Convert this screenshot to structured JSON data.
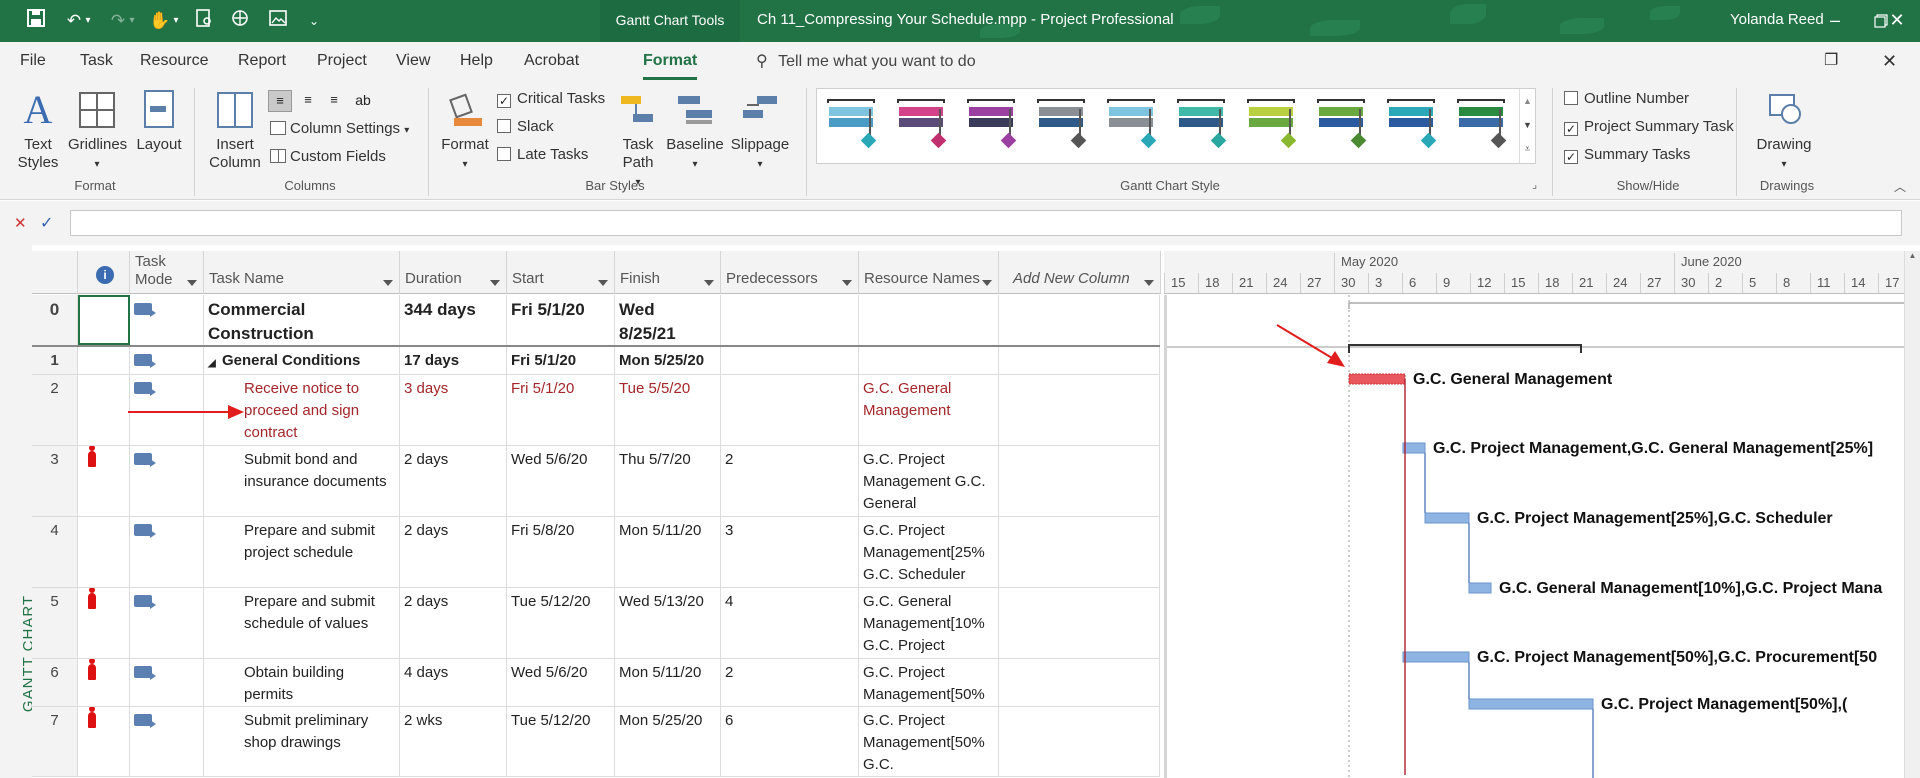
{
  "titlebar": {
    "context_tab": "Gantt Chart Tools",
    "doc_title": "Ch 11_Compressing Your Schedule.mpp  -  Project Professional",
    "user": "Yolanda Reed",
    "qat_more": "⌄"
  },
  "menu": {
    "items": [
      "File",
      "Task",
      "Resource",
      "Report",
      "Project",
      "View",
      "Help",
      "Acrobat",
      "Format"
    ],
    "active": "Format",
    "tell_me": "Tell me what you want to do"
  },
  "ribbon": {
    "format_group": {
      "text_styles": "Text Styles",
      "gridlines": "Gridlines",
      "layout": "Layout",
      "label": "Format"
    },
    "columns_group": {
      "insert_column": "Insert Column",
      "column_settings": "Column Settings",
      "custom_fields": "Custom Fields",
      "label": "Columns"
    },
    "bar_styles_group": {
      "format": "Format",
      "critical_tasks": "Critical Tasks",
      "slack": "Slack",
      "late_tasks": "Late Tasks",
      "task_path": "Task Path",
      "baseline": "Baseline",
      "slippage": "Slippage",
      "label": "Bar Styles",
      "critical_checked": true,
      "slack_checked": false,
      "late_checked": false
    },
    "gantt_style_label": "Gantt Chart Style",
    "gantt_styles": [
      {
        "top": "#7fc4de",
        "bottom": "#4a9cc4",
        "diamond": "#2aa8b8"
      },
      {
        "top": "#d4438a",
        "bottom": "#5a4b7a",
        "diamond": "#c0306e"
      },
      {
        "top": "#9b3fa0",
        "bottom": "#3a3a5a",
        "diamond": "#9b3fa0"
      },
      {
        "top": "#8a8f96",
        "bottom": "#2e5a8a",
        "diamond": "#555555"
      },
      {
        "top": "#7fc4de",
        "bottom": "#8a8f96",
        "diamond": "#2aa8b8"
      },
      {
        "top": "#3fb8a8",
        "bottom": "#2e5a8a",
        "diamond": "#2aa8a0"
      },
      {
        "top": "#b8d040",
        "bottom": "#6aa840",
        "diamond": "#8ab830"
      },
      {
        "top": "#6aa840",
        "bottom": "#2a5aa0",
        "diamond": "#4a8a30"
      },
      {
        "top": "#2aa8b8",
        "bottom": "#2a5aa0",
        "diamond": "#2aa8b8"
      },
      {
        "top": "#2a8a40",
        "bottom": "#3a6aa8",
        "diamond": "#555555"
      }
    ],
    "show_hide": {
      "outline_number": "Outline Number",
      "project_summary_task": "Project Summary Task",
      "summary_tasks": "Summary Tasks",
      "label": "Show/Hide",
      "outline_checked": false,
      "project_summary_checked": true,
      "summary_checked": true
    },
    "drawings": {
      "drawing": "Drawing",
      "label": "Drawings"
    }
  },
  "formula": {
    "cancel": "✕",
    "enter": "✓",
    "value": ""
  },
  "side_label": "GANTT CHART",
  "columns": [
    "",
    "Task Mode",
    "Task Name",
    "Duration",
    "Start",
    "Finish",
    "Predecessors",
    "Resource Names",
    "Add New Column"
  ],
  "rows": [
    {
      "id": "0",
      "mode": "auto",
      "name": "Commercial Construction",
      "indent": 0,
      "summary": true,
      "big": true,
      "duration": "344 days",
      "start": "Fri 5/1/20",
      "finish": "Wed 8/25/21",
      "pred": "",
      "res": "",
      "critical": false,
      "icon": false
    },
    {
      "id": "1",
      "mode": "auto",
      "name": "General Conditions",
      "indent": 1,
      "summary": true,
      "big": false,
      "duration": "17 days",
      "start": "Fri 5/1/20",
      "finish": "Mon 5/25/20",
      "pred": "",
      "res": "",
      "critical": false,
      "icon": false
    },
    {
      "id": "2",
      "mode": "auto",
      "name": "Receive notice to proceed and sign contract",
      "indent": 2,
      "summary": false,
      "big": false,
      "duration": "3 days",
      "start": "Fri 5/1/20",
      "finish": "Tue 5/5/20",
      "pred": "",
      "res": "G.C. General Management",
      "critical": true,
      "icon": false
    },
    {
      "id": "3",
      "mode": "auto",
      "name": "Submit bond and insurance documents",
      "indent": 2,
      "summary": false,
      "big": false,
      "duration": "2 days",
      "start": "Wed 5/6/20",
      "finish": "Thu 5/7/20",
      "pred": "2",
      "res": "G.C. Project Management G.C. General",
      "critical": false,
      "icon": true
    },
    {
      "id": "4",
      "mode": "auto",
      "name": "Prepare and submit project schedule",
      "indent": 2,
      "summary": false,
      "big": false,
      "duration": "2 days",
      "start": "Fri 5/8/20",
      "finish": "Mon 5/11/20",
      "pred": "3",
      "res": "G.C. Project Management[25% G.C. Scheduler",
      "critical": false,
      "icon": false
    },
    {
      "id": "5",
      "mode": "auto",
      "name": "Prepare and submit schedule of values",
      "indent": 2,
      "summary": false,
      "big": false,
      "duration": "2 days",
      "start": "Tue 5/12/20",
      "finish": "Wed 5/13/20",
      "pred": "4",
      "res": "G.C. General Management[10% G.C. Project",
      "critical": false,
      "icon": true
    },
    {
      "id": "6",
      "mode": "auto",
      "name": "Obtain building permits",
      "indent": 2,
      "summary": false,
      "big": false,
      "duration": "4 days",
      "start": "Wed 5/6/20",
      "finish": "Mon 5/11/20",
      "pred": "2",
      "res": "G.C. Project Management[50%",
      "critical": false,
      "icon": true
    },
    {
      "id": "7",
      "mode": "auto",
      "name": "Submit preliminary shop drawings",
      "indent": 2,
      "summary": false,
      "big": false,
      "duration": "2 wks",
      "start": "Tue 5/12/20",
      "finish": "Mon 5/25/20",
      "pred": "6",
      "res": "G.C. Project Management[50% G.C.",
      "critical": false,
      "icon": true
    }
  ],
  "timescale": {
    "months": [
      {
        "label": "May 2020",
        "index": 5
      },
      {
        "label": "June 2020",
        "index": 15
      }
    ],
    "days": [
      "15",
      "18",
      "21",
      "24",
      "27",
      "30",
      "3",
      "6",
      "9",
      "12",
      "15",
      "18",
      "21",
      "24",
      "27",
      "30",
      "2",
      "5",
      "8",
      "11",
      "14",
      "17"
    ]
  },
  "gantt_labels": [
    "G.C. General Management",
    "G.C. Project Management,G.C. General Management[25%]",
    "G.C. Project Management[25%],G.C. Scheduler",
    "G.C. General Management[10%],G.C. Project Mana",
    "G.C. Project Management[50%],G.C. Procurement[50",
    "G.C. Project Management[50%],("
  ],
  "colors": {
    "brand": "#217346",
    "critical": "#e8585e",
    "task": "#8db4e2",
    "annotation": "#e11d1d"
  }
}
